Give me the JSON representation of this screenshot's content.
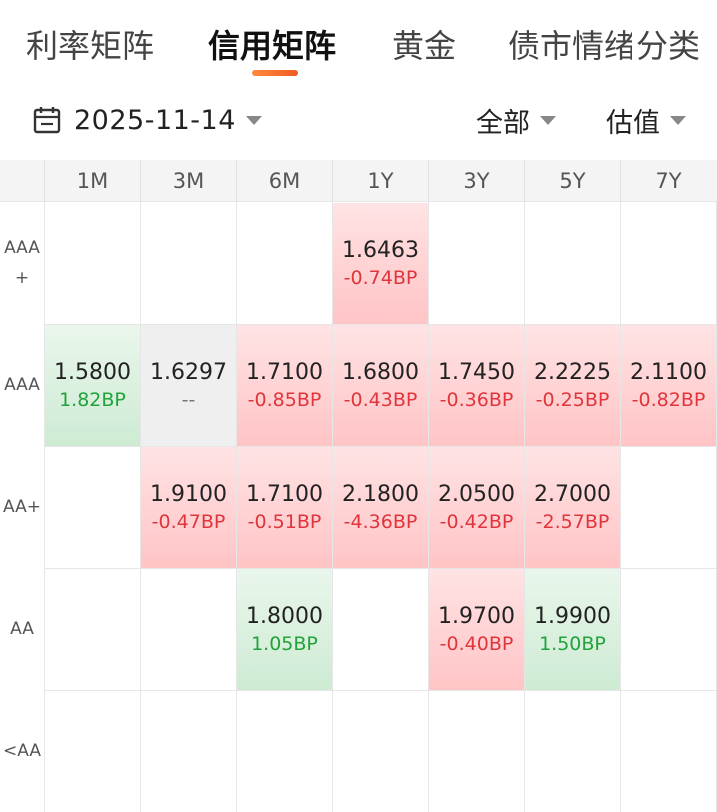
{
  "tabs": [
    {
      "label": "利率矩阵",
      "active": false
    },
    {
      "label": "信用矩阵",
      "active": true
    },
    {
      "label": "黄金",
      "active": false
    },
    {
      "label": "债市情绪",
      "active": false
    },
    {
      "label": "分类",
      "active": false
    }
  ],
  "filters": {
    "date": "2025-11-14",
    "scope": "全部",
    "metric": "估值",
    "calendar_icon": "calendar-icon",
    "caret_icon": "caret-down-icon"
  },
  "matrix": {
    "columns": [
      "1M",
      "3M",
      "6M",
      "1Y",
      "3Y",
      "5Y",
      "7Y"
    ],
    "rows": [
      {
        "label": "AAA\n+",
        "cells": [
          null,
          null,
          null,
          {
            "value": "1.6463",
            "change": "-0.74BP",
            "trend": "up"
          },
          null,
          null,
          null
        ]
      },
      {
        "label": "AAA",
        "cells": [
          {
            "value": "1.5800",
            "change": "1.82BP",
            "trend": "down"
          },
          {
            "value": "1.6297",
            "change": "--",
            "trend": "flat"
          },
          {
            "value": "1.7100",
            "change": "-0.85BP",
            "trend": "up"
          },
          {
            "value": "1.6800",
            "change": "-0.43BP",
            "trend": "up"
          },
          {
            "value": "1.7450",
            "change": "-0.36BP",
            "trend": "up"
          },
          {
            "value": "2.2225",
            "change": "-0.25BP",
            "trend": "up"
          },
          {
            "value": "2.1100",
            "change": "-0.82BP",
            "trend": "up"
          }
        ]
      },
      {
        "label": "AA+",
        "cells": [
          null,
          {
            "value": "1.9100",
            "change": "-0.47BP",
            "trend": "up"
          },
          {
            "value": "1.7100",
            "change": "-0.51BP",
            "trend": "up"
          },
          {
            "value": "2.1800",
            "change": "-4.36BP",
            "trend": "up"
          },
          {
            "value": "2.0500",
            "change": "-0.42BP",
            "trend": "up"
          },
          {
            "value": "2.7000",
            "change": "-2.57BP",
            "trend": "up"
          },
          null
        ]
      },
      {
        "label": "AA",
        "cells": [
          null,
          null,
          {
            "value": "1.8000",
            "change": "1.05BP",
            "trend": "down"
          },
          null,
          {
            "value": "1.9700",
            "change": "-0.40BP",
            "trend": "up"
          },
          {
            "value": "1.9900",
            "change": "1.50BP",
            "trend": "down"
          },
          null
        ]
      },
      {
        "label": "<AA",
        "cells": [
          null,
          null,
          null,
          null,
          null,
          null,
          null
        ]
      }
    ],
    "colors": {
      "up_text": "#e0353b",
      "down_text": "#20a33a",
      "accent": "#f25a22"
    }
  }
}
